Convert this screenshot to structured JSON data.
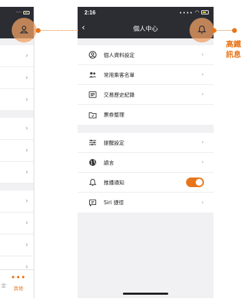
{
  "colors": {
    "accent": "#e8751a",
    "header_bg": "#2b2d33",
    "page_bg": "#f1f1f3"
  },
  "status_bar": {
    "time": "2:16"
  },
  "header": {
    "back_icon": "chevron-left-icon",
    "title": "個人中心",
    "bell_icon": "bell-icon"
  },
  "menu_group_1": [
    {
      "icon": "user-circle-icon",
      "label": "個人資料設定"
    },
    {
      "icon": "users-icon",
      "label": "常用乘客名單"
    },
    {
      "icon": "receipt-list-icon",
      "label": "交易歷史紀錄"
    },
    {
      "icon": "folder-ticket-icon",
      "label": "票券整理"
    }
  ],
  "menu_group_2": [
    {
      "icon": "sliders-icon",
      "label": "提醒設定"
    },
    {
      "icon": "globe-icon",
      "label": "語言"
    },
    {
      "icon": "bell-icon",
      "label": "推播通知",
      "toggle_on": true
    },
    {
      "icon": "siri-chat-icon",
      "label": "Siri 捷徑"
    }
  ],
  "left_screen": {
    "tab_label": "其他",
    "stub_label": "定"
  },
  "callout": {
    "line1": "高鐵",
    "line2": "訊息"
  }
}
